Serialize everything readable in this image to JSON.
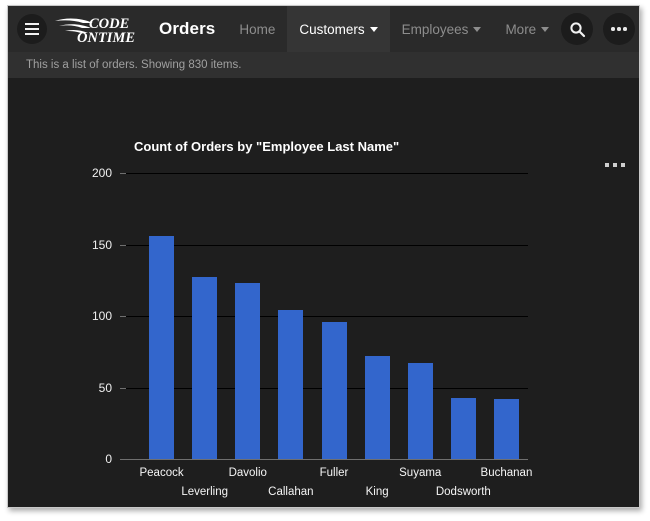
{
  "window": {
    "frame_color": "#c8c8c8",
    "background": "#1e1e1e"
  },
  "navbar": {
    "background": "#2a2a2a",
    "menu_icon": "hamburger-icon",
    "logo": {
      "line1": "CODE",
      "line2": "ONTIME",
      "icon": "wing-swoosh-icon"
    },
    "app_title": "Orders",
    "tabs": [
      {
        "label": "Home",
        "has_caret": false,
        "active": false
      },
      {
        "label": "Customers",
        "has_caret": true,
        "active": true
      },
      {
        "label": "Employees",
        "has_caret": true,
        "active": false
      },
      {
        "label": "More",
        "has_caret": true,
        "active": false
      }
    ],
    "actions": [
      {
        "name": "search-button",
        "icon": "search-icon"
      },
      {
        "name": "overflow-button",
        "icon": "ellipsis-icon"
      }
    ]
  },
  "statusbar": {
    "text": "This is a list of orders. Showing 830 items.",
    "background": "#303030",
    "color": "#a0a0a0"
  },
  "panel": {
    "menu_icon": "ellipsis-icon",
    "background": "#1e1e1e"
  },
  "chart_data": {
    "type": "bar",
    "title": "Count of Orders by \"Employee Last Name\"",
    "xlabel": "",
    "ylabel": "",
    "ylim": [
      0,
      200
    ],
    "yticks": [
      0,
      50,
      100,
      150,
      200
    ],
    "grid": true,
    "legend": false,
    "bar_color": "#3366cc",
    "categories": [
      "Peacock",
      "Leverling",
      "Davolio",
      "Callahan",
      "Fuller",
      "King",
      "Suyama",
      "Dodsworth",
      "Buchanan"
    ],
    "values": [
      156,
      127,
      123,
      104,
      96,
      72,
      67,
      43,
      42
    ]
  }
}
